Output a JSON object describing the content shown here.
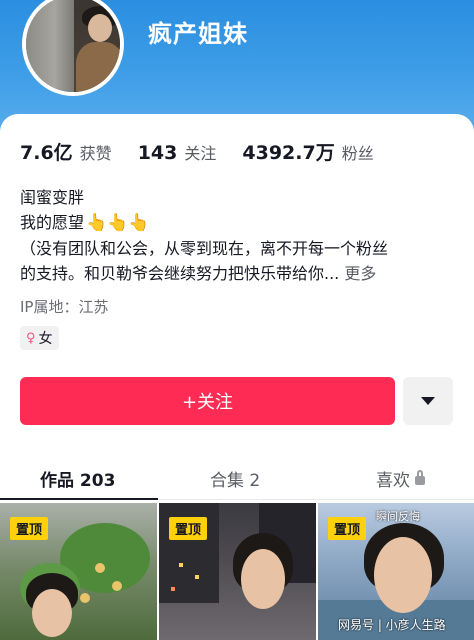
{
  "profile": {
    "username": "疯产姐妹"
  },
  "stats": [
    {
      "value": "7.6亿",
      "label": "获赞"
    },
    {
      "value": "143",
      "label": "关注"
    },
    {
      "value": "4392.7万",
      "label": "粉丝"
    }
  ],
  "bio": {
    "line1": "闺蜜变胖",
    "line2": "我的愿望",
    "hand_glyph": "👆👆👆",
    "line3": "（没有团队和公会，从零到现在，离不开每一个粉丝",
    "line4": "的支持。和贝勒爷会继续努力把快乐带给你...",
    "more": "更多"
  },
  "ip_location": "IP属地：江苏",
  "gender_tag": {
    "icon": "female-symbol-icon",
    "label": "女",
    "color": "#f3527e"
  },
  "actions": {
    "follow_label": "+关注",
    "follow_color": "#fe2c55"
  },
  "tabs": [
    {
      "label": "作品 203",
      "active": true
    },
    {
      "label": "合集 2",
      "active": false
    },
    {
      "label": "喜欢",
      "active": false,
      "icon": "lock-icon"
    }
  ],
  "videos": [
    {
      "badge": "置顶"
    },
    {
      "badge": "置顶"
    },
    {
      "badge": "置顶",
      "caption": "瞬间反悔"
    }
  ],
  "watermark": "网易号 | 小彦人生路"
}
